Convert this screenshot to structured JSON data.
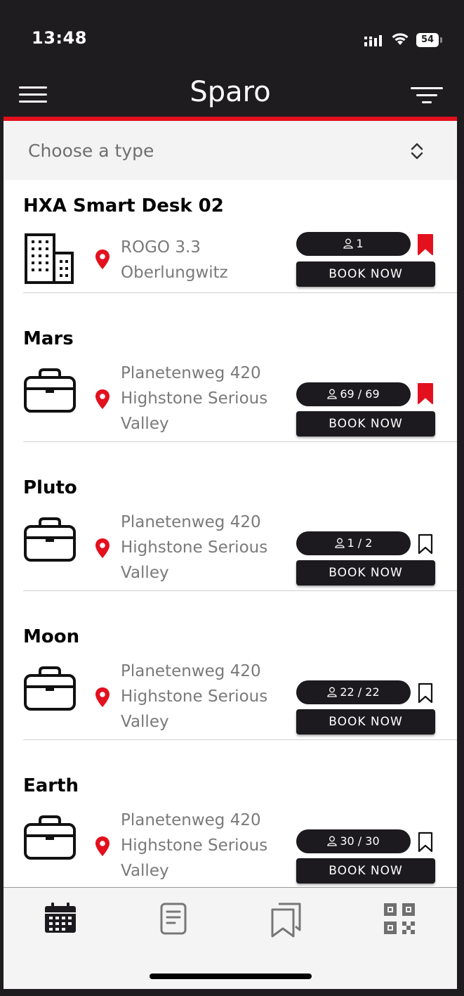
{
  "status": {
    "time": "13:48",
    "battery": "54"
  },
  "header": {
    "title": "Sparo"
  },
  "type_select": {
    "placeholder": "Choose a type"
  },
  "items": [
    {
      "name": "HXA Smart Desk 02",
      "icon": "building-icon",
      "address": [
        "ROGO 3.3",
        "Oberlungwitz"
      ],
      "capacity": "1",
      "book_label": "BOOK NOW",
      "bookmarked": true
    },
    {
      "name": "Mars",
      "icon": "briefcase-icon",
      "address": [
        "Planetenweg 420",
        "Highstone Serious",
        "Valley"
      ],
      "capacity": "69 / 69",
      "book_label": "BOOK NOW",
      "bookmarked": true
    },
    {
      "name": "Pluto",
      "icon": "briefcase-icon",
      "address": [
        "Planetenweg 420",
        "Highstone Serious",
        "Valley"
      ],
      "capacity": "1 / 2",
      "book_label": "BOOK NOW",
      "bookmarked": false
    },
    {
      "name": "Moon",
      "icon": "briefcase-icon",
      "address": [
        "Planetenweg 420",
        "Highstone Serious",
        "Valley"
      ],
      "capacity": "22 / 22",
      "book_label": "BOOK NOW",
      "bookmarked": false
    },
    {
      "name": "Earth",
      "icon": "briefcase-icon",
      "address": [
        "Planetenweg 420",
        "Highstone Serious",
        "Valley"
      ],
      "capacity": "30 / 30",
      "book_label": "BOOK NOW",
      "bookmarked": false
    }
  ],
  "tabs": [
    {
      "icon": "calendar-icon",
      "active": true
    },
    {
      "icon": "document-icon",
      "active": false
    },
    {
      "icon": "bookmarks-icon",
      "active": false
    },
    {
      "icon": "qr-code-icon",
      "active": false
    }
  ],
  "colors": {
    "accent": "#e3101e",
    "dark": "#1f1c1f",
    "pin": "#e3101e"
  }
}
